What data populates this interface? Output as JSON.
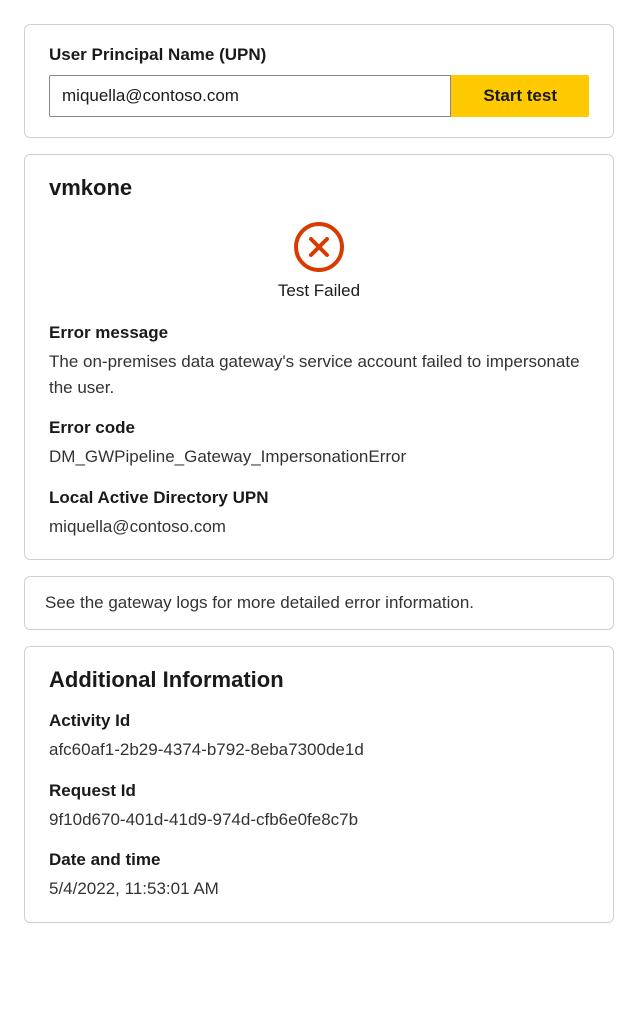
{
  "upn_section": {
    "label": "User Principal Name (UPN)",
    "value": "miquella@contoso.com",
    "button_label": "Start test"
  },
  "result": {
    "hostname": "vmkone",
    "status_text": "Test Failed",
    "error_message_label": "Error message",
    "error_message": "The on-premises data gateway's service account failed to impersonate the user.",
    "error_code_label": "Error code",
    "error_code": "DM_GWPipeline_Gateway_ImpersonationError",
    "local_ad_upn_label": "Local Active Directory UPN",
    "local_ad_upn": "miquella@contoso.com"
  },
  "hint": {
    "text": "See the gateway logs for more detailed error information."
  },
  "additional": {
    "title": "Additional Information",
    "activity_id_label": "Activity Id",
    "activity_id": "afc60af1-2b29-4374-b792-8eba7300de1d",
    "request_id_label": "Request Id",
    "request_id": "9f10d670-401d-41d9-974d-cfb6e0fe8c7b",
    "datetime_label": "Date and time",
    "datetime": "5/4/2022, 11:53:01 AM"
  }
}
